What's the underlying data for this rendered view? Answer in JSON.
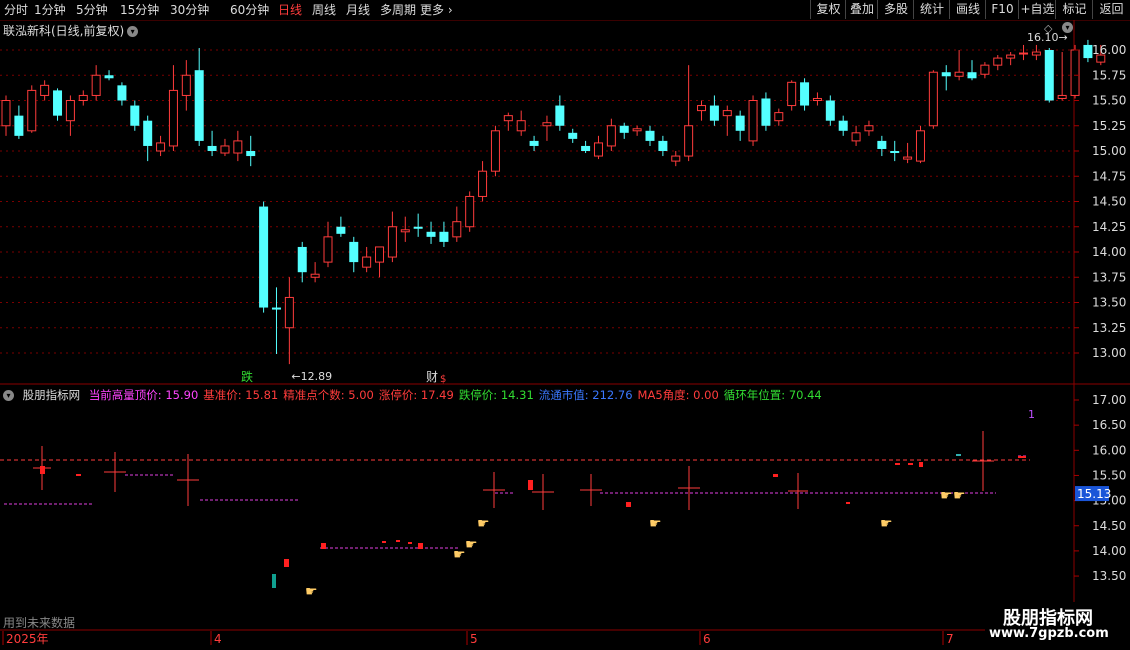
{
  "toolbar": {
    "periods": [
      {
        "label": "分时",
        "active": false
      },
      {
        "label": "1分钟",
        "active": false
      },
      {
        "label": "5分钟",
        "active": false
      },
      {
        "label": "15分钟",
        "active": false
      },
      {
        "label": "30分钟",
        "active": false
      },
      {
        "label": "60分钟",
        "active": false
      },
      {
        "label": "日线",
        "active": true
      },
      {
        "label": "周线",
        "active": false
      },
      {
        "label": "月线",
        "active": false
      },
      {
        "label": "多周期",
        "active": false
      },
      {
        "label": "更多",
        "active": false
      }
    ],
    "right": [
      "复权",
      "叠加",
      "多股",
      "统计",
      "画线",
      "F10",
      "+自选",
      "标记",
      "返回"
    ]
  },
  "stock": {
    "title": "联泓新科(日线,前复权)"
  },
  "main_axis": {
    "ticks": [
      "16.00",
      "15.75",
      "15.50",
      "15.25",
      "15.00",
      "14.75",
      "14.50",
      "14.25",
      "14.00",
      "13.75",
      "13.50",
      "13.25",
      "13.00"
    ]
  },
  "annotations": {
    "high": "16.10",
    "low": "12.89",
    "die": "跌",
    "cai": "财",
    "cai_s": "$"
  },
  "indicator": {
    "name": "股朋指标网",
    "fields": [
      {
        "label": "当前高量顶价:",
        "value": "15.90",
        "color": "#ff44ff"
      },
      {
        "label": "基准价:",
        "value": "15.81",
        "color": "#ff3c3c"
      },
      {
        "label": "精准点个数:",
        "value": "5.00",
        "color": "#ff3c3c"
      },
      {
        "label": "涨停价:",
        "value": "17.49",
        "color": "#ff3c3c"
      },
      {
        "label": "跌停价:",
        "value": "14.31",
        "color": "#32dc32"
      },
      {
        "label": "流通市值:",
        "value": "212.76",
        "color": "#3a78ff"
      },
      {
        "label": "MA5角度:",
        "value": "0.00",
        "color": "#ff3c3c"
      },
      {
        "label": "循环年位置:",
        "value": "70.44",
        "color": "#32dc32"
      }
    ],
    "axis_ticks": [
      "17.00",
      "16.50",
      "16.00",
      "15.50",
      "15.00",
      "14.50",
      "14.00",
      "13.50"
    ],
    "current_label": "15.13",
    "marker": "1"
  },
  "date_axis": [
    "2025年",
    "4",
    "5",
    "6",
    "7"
  ],
  "footer_note": "用到未来数据",
  "watermark": {
    "title": "股朋指标网",
    "url": "www.7gpzb.com"
  },
  "colors": {
    "up": "#ff3c3c",
    "down": "#54ffff",
    "grid": "#7a0000",
    "accent": "#ff3c3c"
  },
  "chart_data": {
    "type": "candlestick",
    "ylim": [
      12.8,
      16.18
    ],
    "candles": [
      {
        "o": 15.25,
        "h": 15.55,
        "l": 15.15,
        "c": 15.5
      },
      {
        "o": 15.35,
        "h": 15.45,
        "l": 15.12,
        "c": 15.15
      },
      {
        "o": 15.2,
        "h": 15.65,
        "l": 15.18,
        "c": 15.6
      },
      {
        "o": 15.55,
        "h": 15.7,
        "l": 15.5,
        "c": 15.65
      },
      {
        "o": 15.6,
        "h": 15.62,
        "l": 15.3,
        "c": 15.35
      },
      {
        "o": 15.3,
        "h": 15.55,
        "l": 15.15,
        "c": 15.5
      },
      {
        "o": 15.5,
        "h": 15.6,
        "l": 15.45,
        "c": 15.55
      },
      {
        "o": 15.55,
        "h": 15.85,
        "l": 15.5,
        "c": 15.75
      },
      {
        "o": 15.75,
        "h": 15.8,
        "l": 15.7,
        "c": 15.72
      },
      {
        "o": 15.65,
        "h": 15.68,
        "l": 15.45,
        "c": 15.5
      },
      {
        "o": 15.45,
        "h": 15.5,
        "l": 15.2,
        "c": 15.25
      },
      {
        "o": 15.3,
        "h": 15.35,
        "l": 14.9,
        "c": 15.05
      },
      {
        "o": 15.0,
        "h": 15.15,
        "l": 14.95,
        "c": 15.08
      },
      {
        "o": 15.05,
        "h": 15.85,
        "l": 15.0,
        "c": 15.6
      },
      {
        "o": 15.55,
        "h": 15.9,
        "l": 15.4,
        "c": 15.75
      },
      {
        "o": 15.8,
        "h": 16.02,
        "l": 15.05,
        "c": 15.1
      },
      {
        "o": 15.05,
        "h": 15.2,
        "l": 14.95,
        "c": 15.0
      },
      {
        "o": 14.98,
        "h": 15.12,
        "l": 14.95,
        "c": 15.05
      },
      {
        "o": 14.98,
        "h": 15.2,
        "l": 14.9,
        "c": 15.1
      },
      {
        "o": 15.0,
        "h": 15.15,
        "l": 14.85,
        "c": 14.95
      },
      {
        "o": 14.45,
        "h": 14.5,
        "l": 13.4,
        "c": 13.45
      },
      {
        "o": 13.45,
        "h": 13.65,
        "l": 12.99,
        "c": 13.43
      },
      {
        "o": 13.25,
        "h": 13.75,
        "l": 12.89,
        "c": 13.55
      },
      {
        "o": 14.05,
        "h": 14.1,
        "l": 13.7,
        "c": 13.8
      },
      {
        "o": 13.75,
        "h": 13.9,
        "l": 13.7,
        "c": 13.78
      },
      {
        "o": 13.9,
        "h": 14.3,
        "l": 13.85,
        "c": 14.15
      },
      {
        "o": 14.25,
        "h": 14.35,
        "l": 14.15,
        "c": 14.18
      },
      {
        "o": 14.1,
        "h": 14.15,
        "l": 13.8,
        "c": 13.9
      },
      {
        "o": 13.85,
        "h": 14.05,
        "l": 13.8,
        "c": 13.95
      },
      {
        "o": 13.9,
        "h": 14.0,
        "l": 13.75,
        "c": 14.05
      },
      {
        "o": 13.95,
        "h": 14.4,
        "l": 13.9,
        "c": 14.25
      },
      {
        "o": 14.2,
        "h": 14.35,
        "l": 14.1,
        "c": 14.22
      },
      {
        "o": 14.25,
        "h": 14.38,
        "l": 14.15,
        "c": 14.23
      },
      {
        "o": 14.2,
        "h": 14.3,
        "l": 14.08,
        "c": 14.15
      },
      {
        "o": 14.2,
        "h": 14.3,
        "l": 14.05,
        "c": 14.1
      },
      {
        "o": 14.15,
        "h": 14.45,
        "l": 14.1,
        "c": 14.3
      },
      {
        "o": 14.25,
        "h": 14.6,
        "l": 14.2,
        "c": 14.55
      },
      {
        "o": 14.55,
        "h": 14.9,
        "l": 14.5,
        "c": 14.8
      },
      {
        "o": 14.8,
        "h": 15.25,
        "l": 14.75,
        "c": 15.2
      },
      {
        "o": 15.3,
        "h": 15.38,
        "l": 15.2,
        "c": 15.35
      },
      {
        "o": 15.2,
        "h": 15.4,
        "l": 15.15,
        "c": 15.3
      },
      {
        "o": 15.1,
        "h": 15.15,
        "l": 15.0,
        "c": 15.05
      },
      {
        "o": 15.25,
        "h": 15.35,
        "l": 15.1,
        "c": 15.28
      },
      {
        "o": 15.45,
        "h": 15.55,
        "l": 15.2,
        "c": 15.25
      },
      {
        "o": 15.18,
        "h": 15.22,
        "l": 15.08,
        "c": 15.12
      },
      {
        "o": 15.05,
        "h": 15.1,
        "l": 14.98,
        "c": 15.0
      },
      {
        "o": 14.95,
        "h": 15.15,
        "l": 14.92,
        "c": 15.08
      },
      {
        "o": 15.05,
        "h": 15.32,
        "l": 15.0,
        "c": 15.25
      },
      {
        "o": 15.25,
        "h": 15.28,
        "l": 15.12,
        "c": 15.18
      },
      {
        "o": 15.2,
        "h": 15.25,
        "l": 15.15,
        "c": 15.22
      },
      {
        "o": 15.2,
        "h": 15.25,
        "l": 15.05,
        "c": 15.1
      },
      {
        "o": 15.1,
        "h": 15.15,
        "l": 14.95,
        "c": 15.0
      },
      {
        "o": 14.9,
        "h": 15.0,
        "l": 14.85,
        "c": 14.95
      },
      {
        "o": 14.95,
        "h": 15.85,
        "l": 14.9,
        "c": 15.25
      },
      {
        "o": 15.4,
        "h": 15.5,
        "l": 15.3,
        "c": 15.45
      },
      {
        "o": 15.45,
        "h": 15.55,
        "l": 15.25,
        "c": 15.3
      },
      {
        "o": 15.35,
        "h": 15.45,
        "l": 15.15,
        "c": 15.4
      },
      {
        "o": 15.35,
        "h": 15.4,
        "l": 15.1,
        "c": 15.2
      },
      {
        "o": 15.1,
        "h": 15.55,
        "l": 15.05,
        "c": 15.5
      },
      {
        "o": 15.52,
        "h": 15.58,
        "l": 15.2,
        "c": 15.25
      },
      {
        "o": 15.3,
        "h": 15.42,
        "l": 15.25,
        "c": 15.38
      },
      {
        "o": 15.45,
        "h": 15.7,
        "l": 15.4,
        "c": 15.68
      },
      {
        "o": 15.68,
        "h": 15.72,
        "l": 15.4,
        "c": 15.45
      },
      {
        "o": 15.5,
        "h": 15.58,
        "l": 15.45,
        "c": 15.52
      },
      {
        "o": 15.5,
        "h": 15.55,
        "l": 15.25,
        "c": 15.3
      },
      {
        "o": 15.3,
        "h": 15.35,
        "l": 15.15,
        "c": 15.2
      },
      {
        "o": 15.1,
        "h": 15.25,
        "l": 15.05,
        "c": 15.18
      },
      {
        "o": 15.2,
        "h": 15.3,
        "l": 15.15,
        "c": 15.25
      },
      {
        "o": 15.1,
        "h": 15.15,
        "l": 14.95,
        "c": 15.02
      },
      {
        "o": 15.0,
        "h": 15.1,
        "l": 14.9,
        "c": 14.98
      },
      {
        "o": 14.92,
        "h": 15.08,
        "l": 14.88,
        "c": 14.94
      },
      {
        "o": 14.9,
        "h": 15.25,
        "l": 14.88,
        "c": 15.2
      },
      {
        "o": 15.25,
        "h": 15.8,
        "l": 15.22,
        "c": 15.78
      },
      {
        "o": 15.78,
        "h": 15.85,
        "l": 15.6,
        "c": 15.74
      },
      {
        "o": 15.74,
        "h": 16.0,
        "l": 15.7,
        "c": 15.78
      },
      {
        "o": 15.78,
        "h": 15.9,
        "l": 15.7,
        "c": 15.72
      },
      {
        "o": 15.76,
        "h": 15.88,
        "l": 15.72,
        "c": 15.85
      },
      {
        "o": 15.85,
        "h": 15.95,
        "l": 15.8,
        "c": 15.92
      },
      {
        "o": 15.92,
        "h": 15.98,
        "l": 15.85,
        "c": 15.95
      },
      {
        "o": 15.96,
        "h": 16.05,
        "l": 15.9,
        "c": 15.97
      },
      {
        "o": 15.95,
        "h": 16.05,
        "l": 15.9,
        "c": 15.98
      },
      {
        "o": 16.0,
        "h": 16.02,
        "l": 15.48,
        "c": 15.5
      },
      {
        "o": 15.52,
        "h": 15.98,
        "l": 15.5,
        "c": 15.55
      },
      {
        "o": 15.55,
        "h": 16.05,
        "l": 15.52,
        "c": 16.0
      },
      {
        "o": 16.05,
        "h": 16.1,
        "l": 15.88,
        "c": 15.92
      },
      {
        "o": 15.88,
        "h": 16.05,
        "l": 15.85,
        "c": 15.95
      }
    ]
  }
}
